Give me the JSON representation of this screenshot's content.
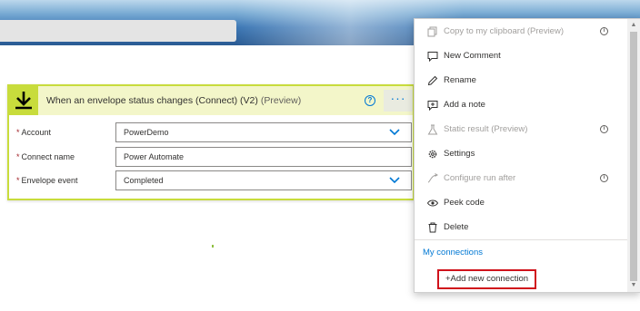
{
  "trigger": {
    "icon": "download-arrow-icon",
    "title": "When an envelope status changes (Connect) (V2)",
    "preview": "(Preview)",
    "more": "···",
    "help": "?",
    "accent": "#c8dc3c",
    "fields": [
      {
        "label": "Account",
        "required": "*",
        "value": "PowerDemo",
        "dropdown": true
      },
      {
        "label": "Connect name",
        "required": "*",
        "value": "Power Automate",
        "dropdown": false
      },
      {
        "label": "Envelope event",
        "required": "*",
        "value": "Completed",
        "dropdown": true
      }
    ]
  },
  "menu": {
    "items": [
      {
        "label": "Copy to my clipboard (Preview)",
        "icon": "copy-icon",
        "disabled": true,
        "info": true
      },
      {
        "label": "New Comment",
        "icon": "comment-icon",
        "disabled": false,
        "info": false
      },
      {
        "label": "Rename",
        "icon": "pencil-icon",
        "disabled": false,
        "info": false
      },
      {
        "label": "Add a note",
        "icon": "note-icon",
        "disabled": false,
        "info": false
      },
      {
        "label": "Static result (Preview)",
        "icon": "flask-icon",
        "disabled": true,
        "info": true
      },
      {
        "label": "Settings",
        "icon": "gear-icon",
        "disabled": false,
        "info": false
      },
      {
        "label": "Configure run after",
        "icon": "run-after-icon",
        "disabled": true,
        "info": true
      },
      {
        "label": "Peek code",
        "icon": "eye-icon",
        "disabled": false,
        "info": false
      },
      {
        "label": "Delete",
        "icon": "trash-icon",
        "disabled": false,
        "info": false
      }
    ],
    "section_label": "My connections",
    "add_connection": "+Add new connection",
    "info_glyph": "i",
    "highlight_color": "#d0121b",
    "link_color": "#0078d4"
  },
  "scrollbar": {
    "up": "▲",
    "down": "▼"
  }
}
